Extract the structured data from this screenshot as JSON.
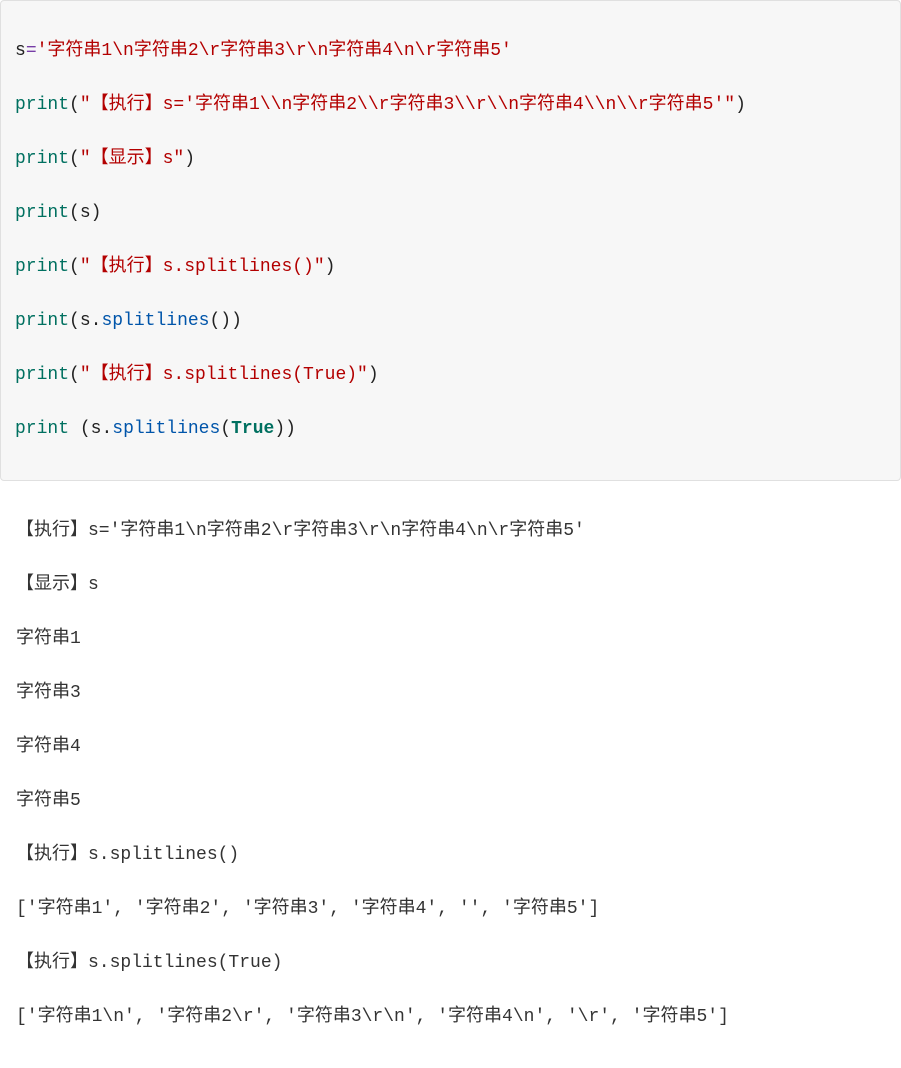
{
  "code": {
    "line1": {
      "var": "s",
      "eq": "=",
      "str": "'字符串1\\n字符串2\\r字符串3\\r\\n字符串4\\n\\r字符串5'"
    },
    "line2": {
      "fn": "print",
      "open": "(",
      "str": "\"【执行】s='字符串1\\\\n字符串2\\\\r字符串3\\\\r\\\\n字符串4\\\\n\\\\r字符串5'\"",
      "close": ")"
    },
    "line3": {
      "fn": "print",
      "open": "(",
      "str": "\"【显示】s\"",
      "close": ")"
    },
    "line4": {
      "fn": "print",
      "open": "(",
      "arg": "s",
      "close": ")"
    },
    "line5": {
      "fn": "print",
      "open": "(",
      "str": "\"【执行】s.splitlines()\"",
      "close": ")"
    },
    "line6": {
      "fn": "print",
      "open": "(",
      "obj": "s",
      "dot": ".",
      "method": "splitlines",
      "args": "()",
      "close": ")"
    },
    "line7": {
      "fn": "print",
      "open": "(",
      "str": "\"【执行】s.splitlines(True)\"",
      "close": ")"
    },
    "line8": {
      "fn": "print",
      "sp": " ",
      "open": "(",
      "obj": "s",
      "dot": ".",
      "method": "splitlines",
      "aopen": "(",
      "bool": "True",
      "aclose": ")",
      "close": ")"
    }
  },
  "output": {
    "l1": "【执行】s='字符串1\\n字符串2\\r字符串3\\r\\n字符串4\\n\\r字符串5'",
    "l2": "【显示】s",
    "l3": "字符串1",
    "l4": "字符串3",
    "l5": "字符串4",
    "l6": "字符串5",
    "l7": "【执行】s.splitlines()",
    "l8": "['字符串1', '字符串2', '字符串3', '字符串4', '', '字符串5']",
    "l9": "【执行】s.splitlines(True)",
    "l10": "['字符串1\\n', '字符串2\\r', '字符串3\\r\\n', '字符串4\\n', '\\r', '字符串5']"
  }
}
